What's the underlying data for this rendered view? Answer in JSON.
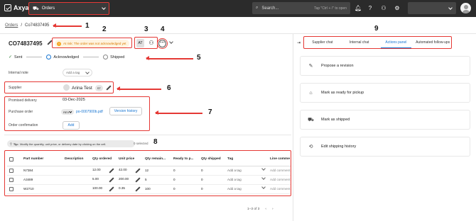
{
  "topbar": {
    "logo": "Axya",
    "module": "Orders",
    "search_placeholder": "Search...",
    "search_hint": "Tap \"Ctrl + /\" to open"
  },
  "breadcrumb": {
    "root": "Orders",
    "sep": "/",
    "current": "Co74837495"
  },
  "order": {
    "id": "CO74837495",
    "status": "At risk: The order was not acknowledged yet",
    "assignee_chip": "AT"
  },
  "steps": [
    "Sent",
    "Acknowledged",
    "Shipped"
  ],
  "internal_note": {
    "label": "Internal note",
    "add_tag": "Add a tag"
  },
  "supplier": {
    "label": "Supplier",
    "name": "Arina Test",
    "chip": "ST"
  },
  "details": {
    "promised_label": "Promised delivery",
    "promised_value": "03-Dec-2025",
    "po_label": "Purchase order",
    "rev_chip": "REV",
    "po_file": "po-0007900b.pdf",
    "version_history": "Version history",
    "confirmation_label": "Order confirmation",
    "add": "Add"
  },
  "tip": {
    "label": "Tip:",
    "text": "Modify the quantity, unit price, or delivery date by clicking on the cell.",
    "selected": "0 selected"
  },
  "table": {
    "headers": [
      "Part number",
      "Description",
      "Qty ordered",
      "Unit price",
      "Qty remain...",
      "Ready to p...",
      "Qty shipped",
      "Tag",
      "Line comme"
    ],
    "rows": [
      {
        "part": "N7384",
        "desc": "",
        "qty": "12.00",
        "price": "42.00",
        "remain": "12",
        "ready": "0",
        "shipped": "0",
        "tag": "Add a tag",
        "comment": "Add comment"
      },
      {
        "part": "A3489",
        "desc": "",
        "qty": "5.00",
        "price": "200.00",
        "remain": "5",
        "ready": "0",
        "shipped": "0",
        "tag": "Add a tag",
        "comment": "Add comment"
      },
      {
        "part": "W2710",
        "desc": "",
        "qty": "100.00",
        "price": "0.35",
        "remain": "100",
        "ready": "0",
        "shipped": "0",
        "tag": "Add a tag",
        "comment": "Add comment"
      }
    ],
    "pagination": "1–3 of 3"
  },
  "panel": {
    "tabs": [
      "Supplier chat",
      "Internal chat",
      "Actions panel",
      "Automated follow-ups"
    ],
    "active_tab": "Actions panel",
    "actions": [
      "Propose a revision",
      "Mark as ready for pickup",
      "Mark as shipped",
      "Edit shipping history"
    ]
  },
  "annotations": [
    "1",
    "2",
    "3",
    "4",
    "5",
    "6",
    "7",
    "8",
    "9"
  ],
  "colors": {
    "topbar": "#2b2b2b",
    "annotation": "#e53935",
    "accent": "#1976d2",
    "warning": "#d97a00",
    "success": "#2e7d32"
  }
}
